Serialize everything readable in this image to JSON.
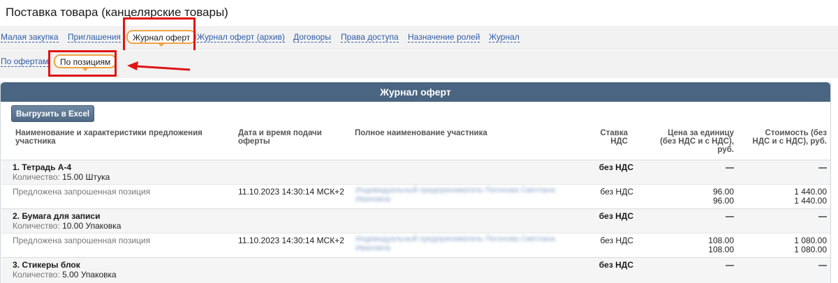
{
  "page_title": "Поставка товара (канцелярские товары)",
  "nav": {
    "items": [
      {
        "label": "Малая закупка"
      },
      {
        "label": "Приглашения"
      },
      {
        "label": "Журнал оферт",
        "active": true
      },
      {
        "label": "Журнал оферт (архив)"
      },
      {
        "label": "Договоры"
      },
      {
        "label": "Права доступа"
      },
      {
        "label": "Назначение ролей"
      },
      {
        "label": "Журнал"
      }
    ]
  },
  "subnav": {
    "items": [
      {
        "label": "По офертам"
      },
      {
        "label": "По позициям",
        "active": true
      }
    ]
  },
  "panel": {
    "title": "Журнал оферт",
    "export_label": "Выгрузить в Excel",
    "columns": {
      "name": "Наименование и характеристики предложения участника",
      "date": "Дата и время подачи оферты",
      "participant": "Полное наименование участника",
      "vat": "Ставка НДС",
      "price": "Цена за единицу (без НДС и с НДС), руб.",
      "cost": "Стоимость (без НДС и с НДС), руб."
    }
  },
  "groups": [
    {
      "title": "1. Тетрадь А-4",
      "qty_label": "Количество:",
      "qty": "15.00 Штука",
      "vat": "без НДС",
      "price": "—",
      "cost": "—",
      "offer": {
        "desc": "Предложена запрошенная позиция",
        "date": "11.10.2023 14:30:14 МСК+2",
        "participant": "Индивидуальный предприниматель Погонова Светлана Ивановна",
        "vat": "без НДС",
        "price1": "96.00",
        "price2": "96.00",
        "cost1": "1 440.00",
        "cost2": "1 440.00"
      }
    },
    {
      "title": "2. Бумага для записи",
      "qty_label": "Количество:",
      "qty": "10.00 Упаковка",
      "vat": "без НДС",
      "price": "—",
      "cost": "—",
      "offer": {
        "desc": "Предложена запрошенная позиция",
        "date": "11.10.2023 14:30:14 МСК+2",
        "participant": "Индивидуальный предприниматель Погонова Светлана Ивановна",
        "vat": "без НДС",
        "price1": "108.00",
        "price2": "108.00",
        "cost1": "1 080.00",
        "cost2": "1 080.00"
      }
    },
    {
      "title": "3. Стикеры блок",
      "qty_label": "Количество:",
      "qty": "5.00 Упаковка",
      "vat": "без НДС",
      "price": "—",
      "cost": "—"
    }
  ],
  "colors": {
    "link": "#2f5da8",
    "active_pill_border": "#f0a341",
    "highlight": "#e01414",
    "panel_header": "#4a6581"
  }
}
